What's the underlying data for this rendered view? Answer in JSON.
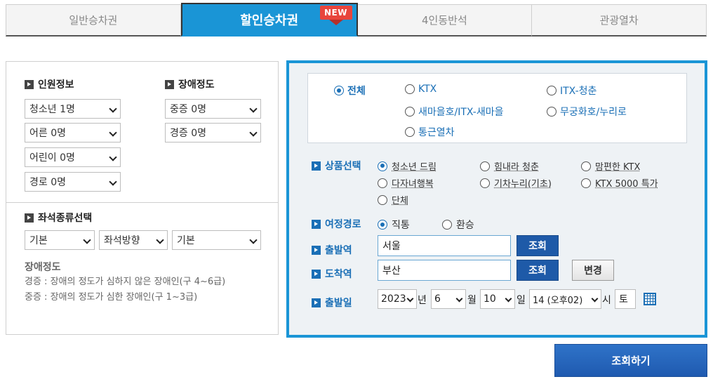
{
  "tabs": [
    {
      "label": "일반승차권"
    },
    {
      "label": "할인승차권",
      "badge": "NEW"
    },
    {
      "label": "4인동반석"
    },
    {
      "label": "관광열차"
    }
  ],
  "passengers": {
    "title": "인원정보",
    "youth": "청소년 1명",
    "adult": "어른 0명",
    "child": "어린이 0명",
    "senior": "경로 0명"
  },
  "disability": {
    "title": "장애정도",
    "severe": "중증 0명",
    "mild": "경증 0명"
  },
  "seat": {
    "title": "좌석종류선택",
    "type": "기본",
    "direction": "좌석방향",
    "position": "기본"
  },
  "notes": {
    "title": "장애정도",
    "line1": "경증 : 장애의 정도가 심하지 않은 장애인(구 4~6급)",
    "line2": "중증 : 장애의 정도가 심한 장애인(구 1~3급)"
  },
  "train_types": {
    "all": "전체",
    "ktx": "KTX",
    "itx_cheongchun": "ITX-청춘",
    "saemaeul": "새마을호/ITX-새마을",
    "mugunghwa": "무궁화호/누리로",
    "commuter": "통근열차"
  },
  "product": {
    "label": "상품선택",
    "options": [
      "청소년 드림",
      "힘내라 청춘",
      "맘편한 KTX",
      "다자녀행복",
      "기차누리(기초)",
      "KTX 5000 특가",
      "단체"
    ]
  },
  "route": {
    "label": "여정경로",
    "direct": "직통",
    "transfer": "환승"
  },
  "departure": {
    "label": "출발역",
    "value": "서울"
  },
  "arrival": {
    "label": "도착역",
    "value": "부산"
  },
  "buttons": {
    "lookup": "조회",
    "change": "변경",
    "search": "조회하기"
  },
  "date": {
    "label": "출발일",
    "year": "2023",
    "year_unit": "년",
    "month": "6",
    "month_unit": "월",
    "day": "10",
    "day_unit": "일",
    "hour": "14 (오후02)",
    "hour_unit": "시",
    "weekday": "토"
  },
  "colors": {
    "accent": "#1a95d6",
    "link": "#1a6fb6",
    "badge": "#e8453c"
  }
}
